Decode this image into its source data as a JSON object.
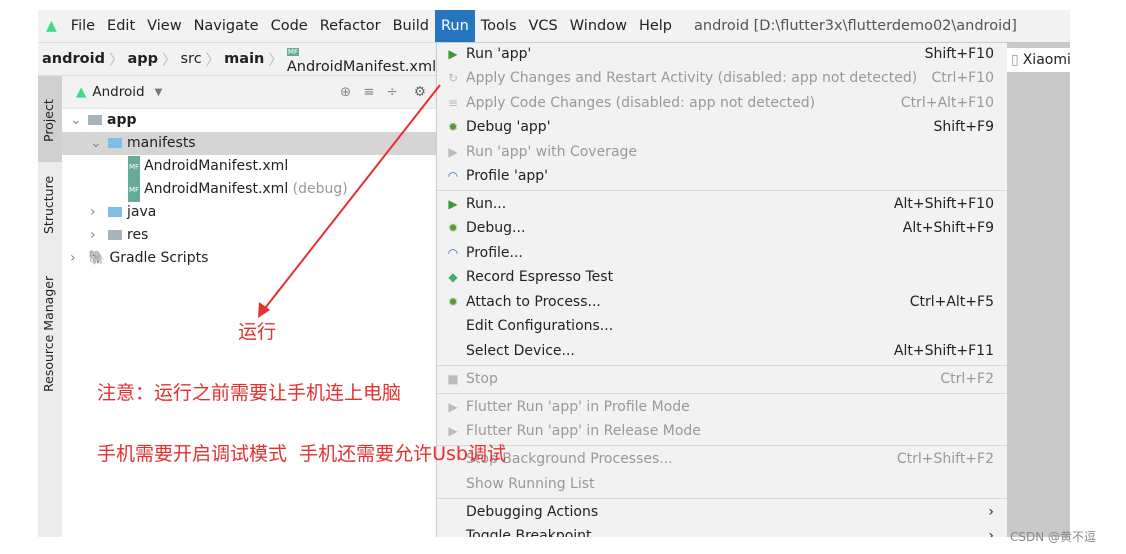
{
  "menubar": {
    "items": [
      "File",
      "Edit",
      "View",
      "Navigate",
      "Code",
      "Refactor",
      "Build",
      "Run",
      "Tools",
      "VCS",
      "Window",
      "Help"
    ],
    "active": "Run",
    "title": "android [D:\\flutter3x\\flutterdemo02\\android]"
  },
  "breadcrumb": [
    "android",
    "app",
    "src",
    "main",
    "AndroidManifest.xml"
  ],
  "side_tabs": [
    "Project",
    "Structure",
    "Resource Manager"
  ],
  "panel": {
    "view": "Android",
    "tree": [
      {
        "label": "app",
        "bold": true
      },
      {
        "label": "manifests"
      },
      {
        "label": "AndroidManifest.xml"
      },
      {
        "label": "AndroidManifest.xml",
        "suffix": "(debug)"
      },
      {
        "label": "java"
      },
      {
        "label": "res"
      },
      {
        "label": "Gradle Scripts"
      }
    ]
  },
  "device": "Xiaomi",
  "run_menu": [
    {
      "label": "Run 'app'",
      "shortcut": "Shift+F10",
      "icon": "play-icon",
      "disabled": false
    },
    {
      "label": "Apply Changes and Restart Activity (disabled: app not detected)",
      "shortcut": "Ctrl+F10",
      "icon": "apply-changes-icon",
      "disabled": true
    },
    {
      "label": "Apply Code Changes (disabled: app not detected)",
      "shortcut": "Ctrl+Alt+F10",
      "icon": "apply-code-icon",
      "disabled": true
    },
    {
      "label": "Debug 'app'",
      "shortcut": "Shift+F9",
      "icon": "bug-icon",
      "disabled": false
    },
    {
      "label": "Run 'app' with Coverage",
      "shortcut": "",
      "icon": "coverage-icon",
      "disabled": true
    },
    {
      "label": "Profile 'app'",
      "shortcut": "",
      "icon": "profile-icon",
      "disabled": false
    },
    {
      "label": "Run...",
      "shortcut": "Alt+Shift+F10",
      "icon": "play-icon",
      "disabled": false
    },
    {
      "label": "Debug...",
      "shortcut": "Alt+Shift+F9",
      "icon": "bug-icon",
      "disabled": false
    },
    {
      "label": "Profile...",
      "shortcut": "",
      "icon": "profile-icon",
      "disabled": false
    },
    {
      "label": "Record Espresso Test",
      "shortcut": "",
      "icon": "espresso-icon",
      "disabled": false
    },
    {
      "label": "Attach to Process...",
      "shortcut": "Ctrl+Alt+F5",
      "icon": "attach-icon",
      "disabled": false
    },
    {
      "label": "Edit Configurations...",
      "shortcut": "",
      "icon": "",
      "disabled": false
    },
    {
      "label": "Select Device...",
      "shortcut": "Alt+Shift+F11",
      "icon": "",
      "disabled": false
    },
    {
      "label": "Stop",
      "shortcut": "Ctrl+F2",
      "icon": "stop-icon",
      "disabled": true
    },
    {
      "label": "Flutter Run 'app' in Profile Mode",
      "shortcut": "",
      "icon": "play-icon",
      "disabled": true
    },
    {
      "label": "Flutter Run 'app' in Release Mode",
      "shortcut": "",
      "icon": "play-icon",
      "disabled": true
    },
    {
      "label": "Stop Background Processes...",
      "shortcut": "Ctrl+Shift+F2",
      "icon": "",
      "disabled": true
    },
    {
      "label": "Show Running List",
      "shortcut": "",
      "icon": "",
      "disabled": true
    },
    {
      "label": "Debugging Actions",
      "shortcut": "›",
      "icon": "",
      "disabled": false
    },
    {
      "label": "Toggle Breakpoint",
      "shortcut": "›",
      "icon": "",
      "disabled": false
    }
  ],
  "annotations": {
    "arrow_label": "运行",
    "note1": "注意：运行之前需要让手机连上电脑",
    "note2": "手机需要开启调试模式  手机还需要允许Usb调试",
    "color": "#e53030"
  },
  "watermark": "CSDN @黄不逗"
}
